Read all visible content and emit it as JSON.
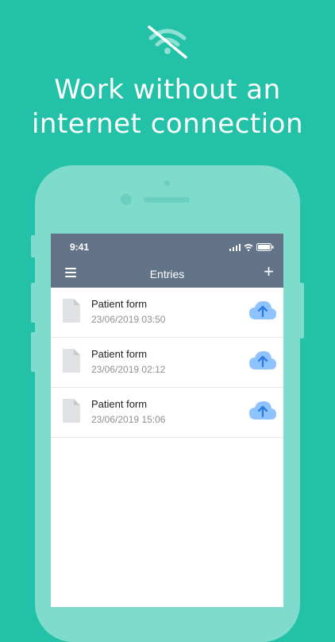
{
  "headline": {
    "line1": "Work without an",
    "line2": "internet connection"
  },
  "icons": {
    "top": "wifi-off-icon",
    "document": "document-icon",
    "upload": "cloud-upload-icon",
    "menu": "hamburger-menu-icon"
  },
  "colors": {
    "background": "#22c1a8",
    "phone": "#7fdccd",
    "navbar": "#637488",
    "cloud": "#8fc3ff",
    "arrow": "#2f7de1"
  },
  "status_bar": {
    "time": "9:41"
  },
  "navbar": {
    "title": "Entries",
    "add_label": "+"
  },
  "entries": [
    {
      "title": "Patient form",
      "date": "23/06/2019 03:50"
    },
    {
      "title": "Patient form",
      "date": "23/06/2019 02:12"
    },
    {
      "title": "Patient form",
      "date": "23/06/2019 15:06"
    }
  ]
}
